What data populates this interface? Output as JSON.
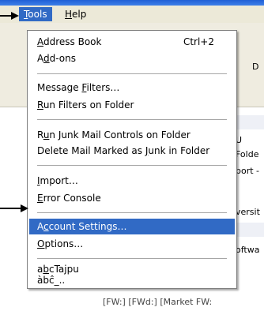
{
  "menubar": {
    "tools_accel": "T",
    "tools_rest": "ools",
    "help_accel": "H",
    "help_rest": "elp"
  },
  "menu": {
    "items": [
      {
        "pre": "",
        "accel": "A",
        "post": "ddress Book",
        "shortcut": "Ctrl+2"
      },
      {
        "pre": "A",
        "accel": "d",
        "post": "d-ons",
        "shortcut": ""
      },
      {
        "pre": "Message ",
        "accel": "F",
        "post": "ilters…",
        "shortcut": ""
      },
      {
        "pre": "",
        "accel": "R",
        "post": "un Filters on Folder",
        "shortcut": ""
      },
      {
        "pre": "R",
        "accel": "u",
        "post": "n Junk Mail Controls on Folder",
        "shortcut": ""
      },
      {
        "pre": "Delete Mail Marked as ",
        "accel": "J",
        "post": "unk in Folder",
        "shortcut": ""
      },
      {
        "pre": "",
        "accel": "I",
        "post": "mport…",
        "shortcut": ""
      },
      {
        "pre": "",
        "accel": "E",
        "post": "rror Console",
        "shortcut": ""
      },
      {
        "pre": "A",
        "accel": "c",
        "post": "count Settings…",
        "shortcut": ""
      },
      {
        "pre": "",
        "accel": "O",
        "post": "ptions…",
        "shortcut": ""
      },
      {
        "pre": "a",
        "accel": "b",
        "post": "cTajpu",
        "shortcut": ""
      },
      {
        "pre": "àbĉ",
        "accel": "_",
        "post": "..",
        "shortcut": ""
      }
    ]
  },
  "background": {
    "toolbar_letter": "D",
    "right_fragments": [
      "U",
      "Folde",
      "port -",
      "versit",
      "oftwa"
    ],
    "bottom_fragment": "[FW:] [FWd:] [Market FW:"
  },
  "colors": {
    "selection": "#316ac5",
    "menubar": "#ece9d8",
    "titlebar": "#1f5fd6"
  }
}
